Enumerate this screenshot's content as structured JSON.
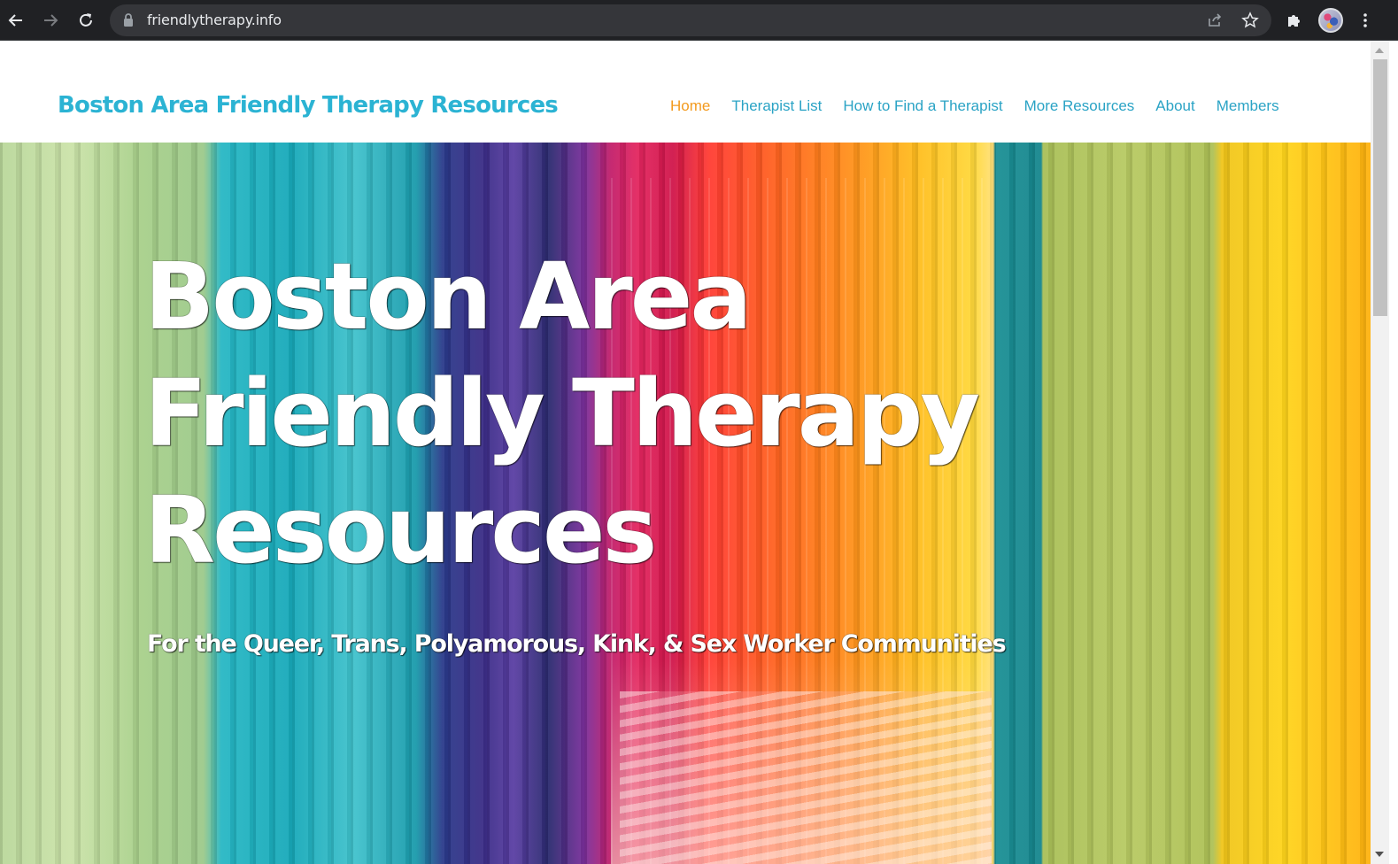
{
  "browser": {
    "url": "friendlytherapy.info",
    "icons": {
      "back": "arrow-left-icon",
      "forward": "arrow-right-icon",
      "reload": "reload-icon",
      "secure": "lock-icon",
      "share": "share-icon",
      "bookmark": "star-icon",
      "extensions": "puzzle-icon",
      "profile": "avatar",
      "menu": "kebab-menu-icon"
    }
  },
  "site": {
    "title": "Boston Area Friendly Therapy Resources",
    "nav": [
      {
        "label": "Home",
        "active": true
      },
      {
        "label": "Therapist List",
        "active": false
      },
      {
        "label": "How to Find a Therapist",
        "active": false
      },
      {
        "label": "More Resources",
        "active": false
      },
      {
        "label": "About",
        "active": false
      },
      {
        "label": "Members",
        "active": false
      }
    ]
  },
  "hero": {
    "title": "Boston Area Friendly Therapy Resources",
    "subtitle": "For the Queer, Trans, Polyamorous, Kink, & Sex Worker Communities"
  },
  "colors": {
    "title_accent": "#2bb3d3",
    "nav_link": "#2aa3c5",
    "nav_active": "#f39a1e",
    "chrome_bg": "#202124",
    "omnibox_bg": "#35363a"
  }
}
